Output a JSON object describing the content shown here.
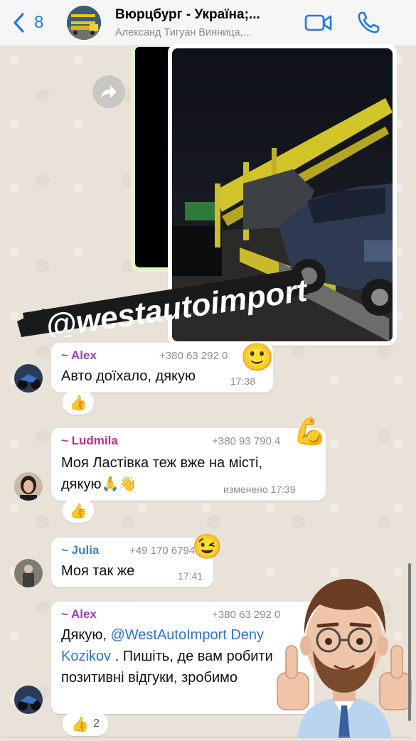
{
  "header": {
    "back_count": "8",
    "title": "Вюрцбург - Україна;...",
    "subtitle": "Александ Тигуан Винница,..."
  },
  "watermark": {
    "text": "@westautoimport"
  },
  "messages": [
    {
      "sender": "~ Alex",
      "phone": "+380 63 292 0",
      "text": "Авто доїхало, дякую",
      "time": "17:38",
      "reaction": "👍",
      "sticker": "🙂"
    },
    {
      "sender": "~ Ludmila",
      "phone": "+380 93 790 4",
      "line1": "Моя Ластівка теж вже на місті,",
      "line2": "дякую🙏👋",
      "time": "изменено 17:39",
      "reaction": "👍",
      "sticker": "💪"
    },
    {
      "sender": "~ Julia",
      "phone": "+49 170 6794",
      "text": "Моя так же",
      "time": "17:41",
      "sticker": "😉"
    },
    {
      "sender": "~ Alex",
      "phone": "+380 63 292 0",
      "line1_prefix": "Дякую, ",
      "mention_part1": "@WestAutoImport Deny",
      "mention_part2": "Kozikov",
      "line2_suffix": " . Пишіть, де вам робити",
      "line3": "позитивні відгуки, зробимо",
      "reaction": "👍",
      "reaction_count": "2"
    }
  ],
  "colors": {
    "accent": "#1f7aea",
    "alex": "#9b3fb5",
    "ludmila": "#b5357d",
    "julia": "#3c83c7",
    "mention": "#2d73c9",
    "watermark_bg": "#1a1a1a"
  }
}
